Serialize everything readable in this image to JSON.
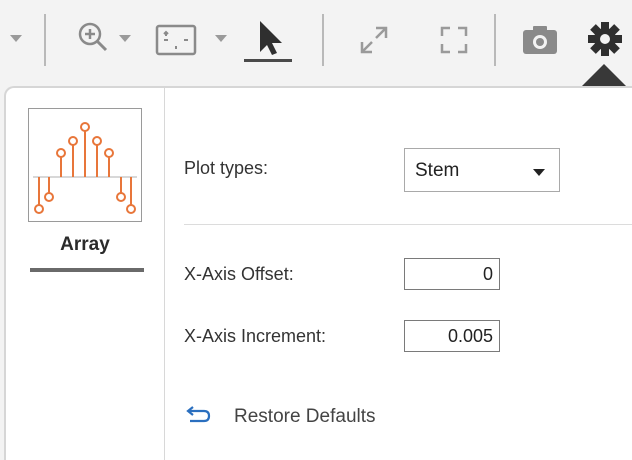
{
  "toolbar": {
    "icons": [
      "chevron-down-icon",
      "zoom-in-icon",
      "fit-view-icon",
      "select-pointer-icon",
      "expand-icon",
      "fullscreen-icon",
      "camera-icon",
      "gear-icon"
    ]
  },
  "sidebar": {
    "array_label": "Array"
  },
  "settings": {
    "plot_types_label": "Plot types:",
    "plot_type_value": "Stem",
    "x_offset_label": "X-Axis Offset:",
    "x_offset_value": "0",
    "x_increment_label": "X-Axis Increment:",
    "x_increment_value": "0.005",
    "restore_label": "Restore Defaults"
  },
  "colors": {
    "accent_orange": "#e8763a",
    "icon_gray": "#8a8a8a",
    "icon_dark": "#2f2f2f"
  }
}
